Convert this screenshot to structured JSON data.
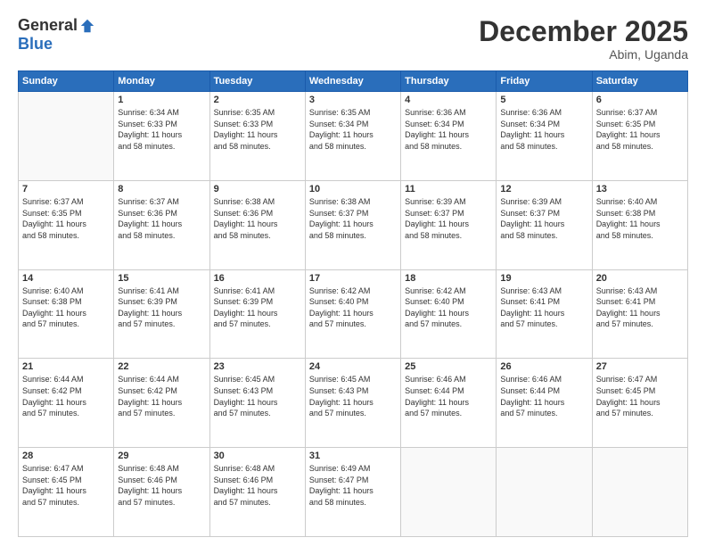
{
  "header": {
    "logo_general": "General",
    "logo_blue": "Blue",
    "month_title": "December 2025",
    "location": "Abim, Uganda"
  },
  "days_of_week": [
    "Sunday",
    "Monday",
    "Tuesday",
    "Wednesday",
    "Thursday",
    "Friday",
    "Saturday"
  ],
  "weeks": [
    [
      {
        "day": "",
        "content": ""
      },
      {
        "day": "1",
        "content": "Sunrise: 6:34 AM\nSunset: 6:33 PM\nDaylight: 11 hours\nand 58 minutes."
      },
      {
        "day": "2",
        "content": "Sunrise: 6:35 AM\nSunset: 6:33 PM\nDaylight: 11 hours\nand 58 minutes."
      },
      {
        "day": "3",
        "content": "Sunrise: 6:35 AM\nSunset: 6:34 PM\nDaylight: 11 hours\nand 58 minutes."
      },
      {
        "day": "4",
        "content": "Sunrise: 6:36 AM\nSunset: 6:34 PM\nDaylight: 11 hours\nand 58 minutes."
      },
      {
        "day": "5",
        "content": "Sunrise: 6:36 AM\nSunset: 6:34 PM\nDaylight: 11 hours\nand 58 minutes."
      },
      {
        "day": "6",
        "content": "Sunrise: 6:37 AM\nSunset: 6:35 PM\nDaylight: 11 hours\nand 58 minutes."
      }
    ],
    [
      {
        "day": "7",
        "content": "Sunrise: 6:37 AM\nSunset: 6:35 PM\nDaylight: 11 hours\nand 58 minutes."
      },
      {
        "day": "8",
        "content": "Sunrise: 6:37 AM\nSunset: 6:36 PM\nDaylight: 11 hours\nand 58 minutes."
      },
      {
        "day": "9",
        "content": "Sunrise: 6:38 AM\nSunset: 6:36 PM\nDaylight: 11 hours\nand 58 minutes."
      },
      {
        "day": "10",
        "content": "Sunrise: 6:38 AM\nSunset: 6:37 PM\nDaylight: 11 hours\nand 58 minutes."
      },
      {
        "day": "11",
        "content": "Sunrise: 6:39 AM\nSunset: 6:37 PM\nDaylight: 11 hours\nand 58 minutes."
      },
      {
        "day": "12",
        "content": "Sunrise: 6:39 AM\nSunset: 6:37 PM\nDaylight: 11 hours\nand 58 minutes."
      },
      {
        "day": "13",
        "content": "Sunrise: 6:40 AM\nSunset: 6:38 PM\nDaylight: 11 hours\nand 58 minutes."
      }
    ],
    [
      {
        "day": "14",
        "content": "Sunrise: 6:40 AM\nSunset: 6:38 PM\nDaylight: 11 hours\nand 57 minutes."
      },
      {
        "day": "15",
        "content": "Sunrise: 6:41 AM\nSunset: 6:39 PM\nDaylight: 11 hours\nand 57 minutes."
      },
      {
        "day": "16",
        "content": "Sunrise: 6:41 AM\nSunset: 6:39 PM\nDaylight: 11 hours\nand 57 minutes."
      },
      {
        "day": "17",
        "content": "Sunrise: 6:42 AM\nSunset: 6:40 PM\nDaylight: 11 hours\nand 57 minutes."
      },
      {
        "day": "18",
        "content": "Sunrise: 6:42 AM\nSunset: 6:40 PM\nDaylight: 11 hours\nand 57 minutes."
      },
      {
        "day": "19",
        "content": "Sunrise: 6:43 AM\nSunset: 6:41 PM\nDaylight: 11 hours\nand 57 minutes."
      },
      {
        "day": "20",
        "content": "Sunrise: 6:43 AM\nSunset: 6:41 PM\nDaylight: 11 hours\nand 57 minutes."
      }
    ],
    [
      {
        "day": "21",
        "content": "Sunrise: 6:44 AM\nSunset: 6:42 PM\nDaylight: 11 hours\nand 57 minutes."
      },
      {
        "day": "22",
        "content": "Sunrise: 6:44 AM\nSunset: 6:42 PM\nDaylight: 11 hours\nand 57 minutes."
      },
      {
        "day": "23",
        "content": "Sunrise: 6:45 AM\nSunset: 6:43 PM\nDaylight: 11 hours\nand 57 minutes."
      },
      {
        "day": "24",
        "content": "Sunrise: 6:45 AM\nSunset: 6:43 PM\nDaylight: 11 hours\nand 57 minutes."
      },
      {
        "day": "25",
        "content": "Sunrise: 6:46 AM\nSunset: 6:44 PM\nDaylight: 11 hours\nand 57 minutes."
      },
      {
        "day": "26",
        "content": "Sunrise: 6:46 AM\nSunset: 6:44 PM\nDaylight: 11 hours\nand 57 minutes."
      },
      {
        "day": "27",
        "content": "Sunrise: 6:47 AM\nSunset: 6:45 PM\nDaylight: 11 hours\nand 57 minutes."
      }
    ],
    [
      {
        "day": "28",
        "content": "Sunrise: 6:47 AM\nSunset: 6:45 PM\nDaylight: 11 hours\nand 57 minutes."
      },
      {
        "day": "29",
        "content": "Sunrise: 6:48 AM\nSunset: 6:46 PM\nDaylight: 11 hours\nand 57 minutes."
      },
      {
        "day": "30",
        "content": "Sunrise: 6:48 AM\nSunset: 6:46 PM\nDaylight: 11 hours\nand 57 minutes."
      },
      {
        "day": "31",
        "content": "Sunrise: 6:49 AM\nSunset: 6:47 PM\nDaylight: 11 hours\nand 58 minutes."
      },
      {
        "day": "",
        "content": ""
      },
      {
        "day": "",
        "content": ""
      },
      {
        "day": "",
        "content": ""
      }
    ]
  ]
}
